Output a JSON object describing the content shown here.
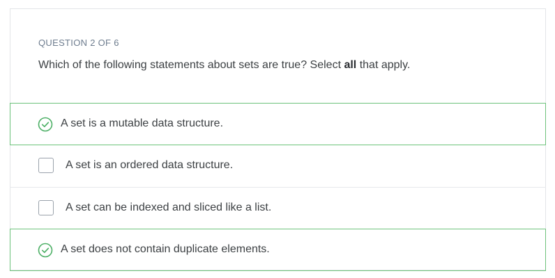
{
  "question": {
    "counter": "QUESTION 2 OF 6",
    "text_before": "Which of the following statements about sets are true? Select ",
    "text_bold": "all",
    "text_after": " that apply."
  },
  "options": [
    {
      "label": "A set is a mutable data structure.",
      "state": "correct",
      "icon": "check-circle-icon"
    },
    {
      "label": "A set is an ordered data structure.",
      "state": "unchecked",
      "icon": "checkbox"
    },
    {
      "label": "A set can be indexed and sliced like a list.",
      "state": "unchecked",
      "icon": "checkbox"
    },
    {
      "label": "A set does not contain duplicate elements.",
      "state": "correct",
      "icon": "check-circle-icon"
    }
  ],
  "colors": {
    "correct_border": "#6cc27a",
    "correct_icon": "#4caf65",
    "counter_text": "#6d7c8e"
  }
}
